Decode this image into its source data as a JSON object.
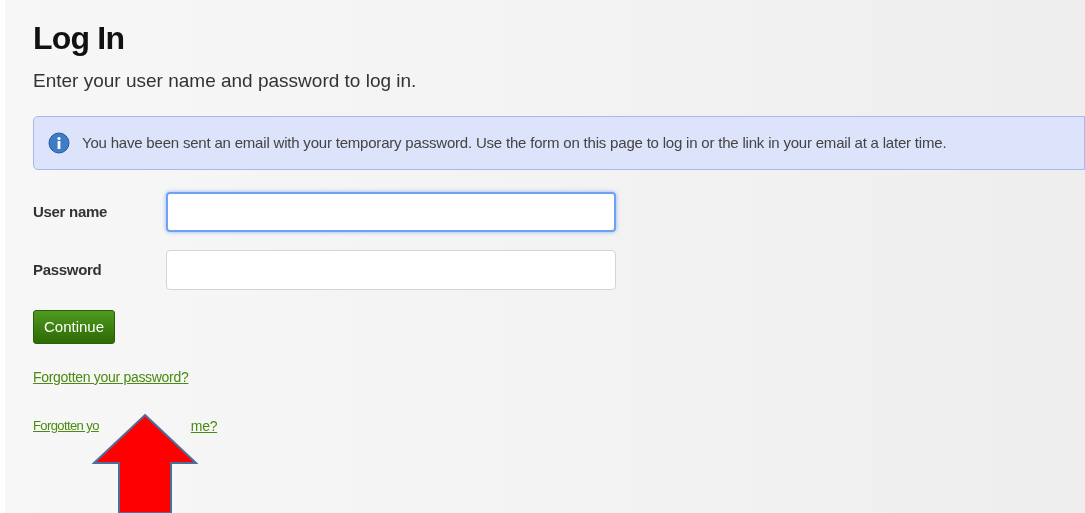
{
  "title": "Log In",
  "subtitle": "Enter your user name and password to log in.",
  "notice": "You have been sent an email with your temporary password. Use the form on this page to log in or the link in your email at a later time.",
  "fields": [
    {
      "label": "User name",
      "focused": true
    },
    {
      "label": "Password",
      "focused": false
    }
  ],
  "button": "Continue",
  "links": [
    {
      "text": "Forgotten your password?"
    }
  ],
  "partly_covered_link": {
    "visible_start": "Forgotten yo",
    "visible_end": "me?"
  }
}
